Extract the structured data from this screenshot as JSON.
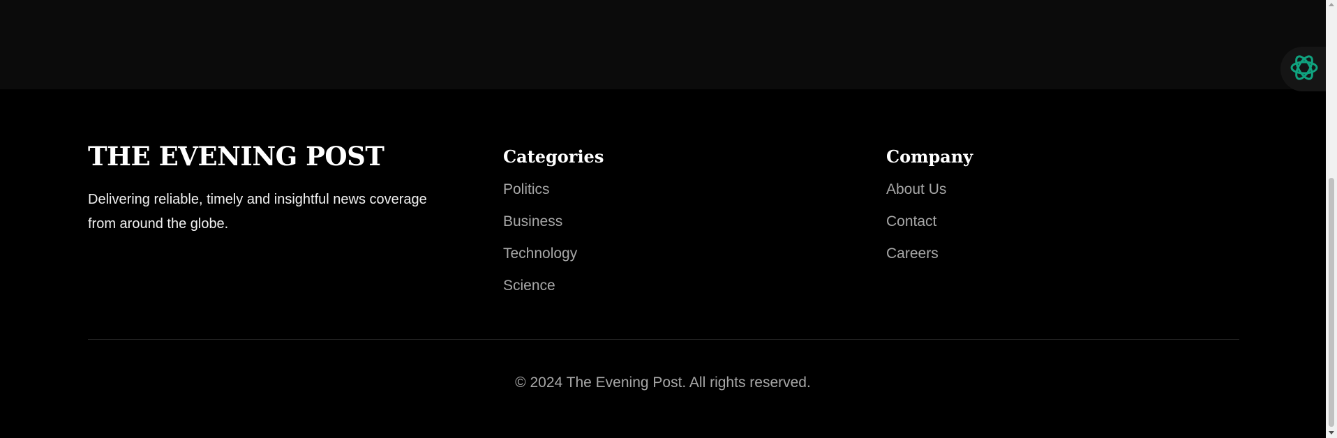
{
  "brand": {
    "title": "THE EVENING POST",
    "tagline": "Delivering reliable, timely and insightful news coverage from around the globe."
  },
  "categories": {
    "heading": "Categories",
    "items": [
      {
        "label": "Politics"
      },
      {
        "label": "Business"
      },
      {
        "label": "Technology"
      },
      {
        "label": "Science"
      }
    ]
  },
  "company": {
    "heading": "Company",
    "items": [
      {
        "label": "About Us"
      },
      {
        "label": "Contact"
      },
      {
        "label": "Careers"
      }
    ]
  },
  "copyright": "© 2024 The Evening Post. All rights reserved.",
  "assistant": {
    "icon": "ai-assistant-icon",
    "accent_color": "#10a37f"
  },
  "colors": {
    "background": "#000000",
    "content_background": "#0b0b0b",
    "heading_text": "#ffffff",
    "link_text": "#a7a7a7"
  }
}
